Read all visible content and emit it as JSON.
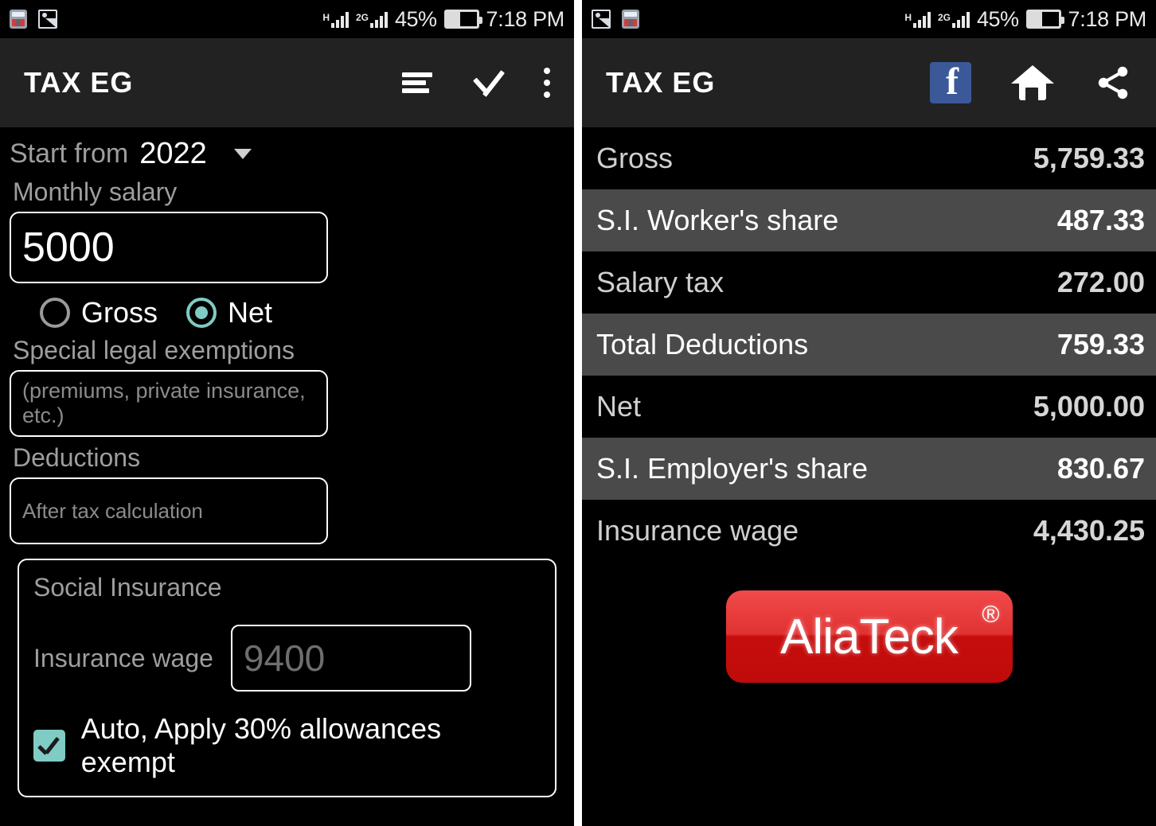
{
  "status_bar": {
    "icons": [
      "calculator-icon",
      "gallery-icon"
    ],
    "network_h_label": "H",
    "network_2g_label": "2G",
    "battery_percent": "45%",
    "clock": "7:18 PM"
  },
  "left_screen": {
    "appbar": {
      "title": "TAX EG",
      "actions": [
        "sort-icon",
        "check-icon",
        "overflow-menu-icon"
      ]
    },
    "form": {
      "start_from_label": "Start from",
      "year_value": "2022",
      "monthly_salary_label": "Monthly salary",
      "monthly_salary_value": "5000",
      "radio_gross_label": "Gross",
      "radio_net_label": "Net",
      "selected_radio": "Net",
      "special_exemptions_label": "Special legal exemptions",
      "special_exemptions_placeholder": "(premiums, private insurance, etc.)",
      "special_exemptions_value": "",
      "deductions_label": "Deductions",
      "deductions_placeholder": "After tax calculation",
      "deductions_value": "",
      "social_insurance_title": "Social Insurance",
      "insurance_wage_label": "Insurance wage",
      "insurance_wage_placeholder": "9400",
      "insurance_wage_value": "",
      "auto_checkbox_label": "Auto, Apply 30% allowances exempt",
      "auto_checkbox_checked": true
    }
  },
  "right_screen": {
    "appbar": {
      "title": "TAX EG",
      "actions": [
        "facebook-icon",
        "home-icon",
        "share-icon"
      ]
    },
    "results": [
      {
        "label": "Gross",
        "value": "5,759.33",
        "highlighted": false
      },
      {
        "label": "S.I. Worker's share",
        "value": "487.33",
        "highlighted": true
      },
      {
        "label": "Salary tax",
        "value": "272.00",
        "highlighted": false
      },
      {
        "label": "Total Deductions",
        "value": "759.33",
        "highlighted": true
      },
      {
        "label": "Net",
        "value": "5,000.00",
        "highlighted": false
      },
      {
        "label": "S.I. Employer's share",
        "value": "830.67",
        "highlighted": true
      },
      {
        "label": "Insurance wage",
        "value": "4,430.25",
        "highlighted": false
      }
    ],
    "logo": {
      "text": "AliaTeck",
      "trademark": "®"
    }
  },
  "colors": {
    "accent": "#80cbc4",
    "appbar": "#222222",
    "background": "#000000",
    "row_highlight": "#4a4a4a",
    "facebook": "#3b5998",
    "logo_red": "#d01010"
  }
}
